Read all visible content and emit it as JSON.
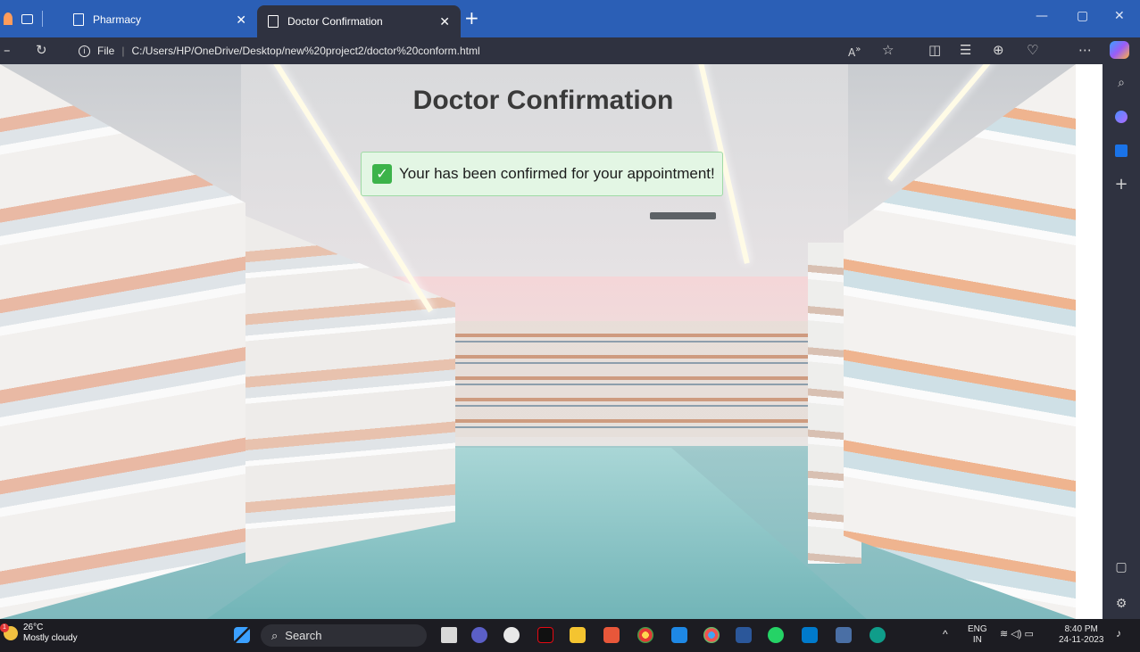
{
  "browser": {
    "tabs": [
      {
        "label": "Pharmacy",
        "active": false
      },
      {
        "label": "Doctor Confirmation",
        "active": true
      }
    ],
    "address": {
      "scheme_label": "File",
      "url": "C:/Users/HP/OneDrive/Desktop/new%20project2/doctor%20conform.html"
    }
  },
  "page": {
    "title": "Doctor Confirmation",
    "message": "Your has been confirmed for your appointment!",
    "check_glyph": "✓",
    "accent": "#3cb34a"
  },
  "taskbar": {
    "weather_temp": "26°C",
    "weather_desc": "Mostly cloudy",
    "weather_badge": "1",
    "search_placeholder": "Search",
    "lang_top": "ENG",
    "lang_bottom": "IN",
    "time": "8:40 PM",
    "date": "24-11-2023"
  },
  "colors": {
    "tab_bar": "#2b5fb6",
    "toolbar": "#2f3240",
    "taskbar": "#1c1c22"
  }
}
